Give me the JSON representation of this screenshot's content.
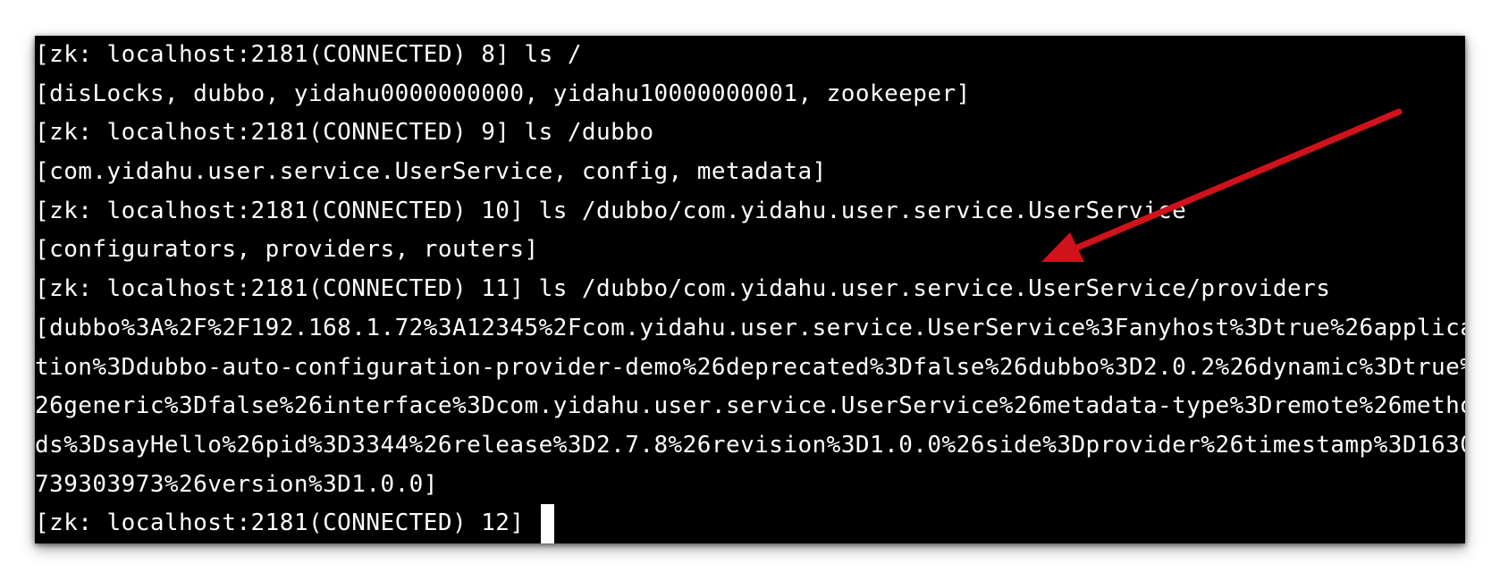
{
  "terminal": {
    "lines": [
      "[zk: localhost:2181(CONNECTED) 8] ls /",
      "[disLocks, dubbo, yidahu0000000000, yidahu10000000001, zookeeper]",
      "[zk: localhost:2181(CONNECTED) 9] ls /dubbo",
      "[com.yidahu.user.service.UserService, config, metadata]",
      "[zk: localhost:2181(CONNECTED) 10] ls /dubbo/com.yidahu.user.service.UserService",
      "[configurators, providers, routers]",
      "[zk: localhost:2181(CONNECTED) 11] ls /dubbo/com.yidahu.user.service.UserService/providers",
      "[dubbo%3A%2F%2F192.168.1.72%3A12345%2Fcom.yidahu.user.service.UserService%3Fanyhost%3Dtrue%26applica",
      "tion%3Ddubbo-auto-configuration-provider-demo%26deprecated%3Dfalse%26dubbo%3D2.0.2%26dynamic%3Dtrue%",
      "26generic%3Dfalse%26interface%3Dcom.yidahu.user.service.UserService%26metadata-type%3Dremote%26metho",
      "ds%3DsayHello%26pid%3D3344%26release%3D2.7.8%26revision%3D1.0.0%26side%3Dprovider%26timestamp%3D1630",
      "739303973%26version%3D1.0.0]",
      "[zk: localhost:2181(CONNECTED) 12]"
    ],
    "colors": {
      "background": "#000000",
      "foreground": "#ffffff"
    }
  },
  "annotation": {
    "arrow_color": "#d0121b"
  }
}
